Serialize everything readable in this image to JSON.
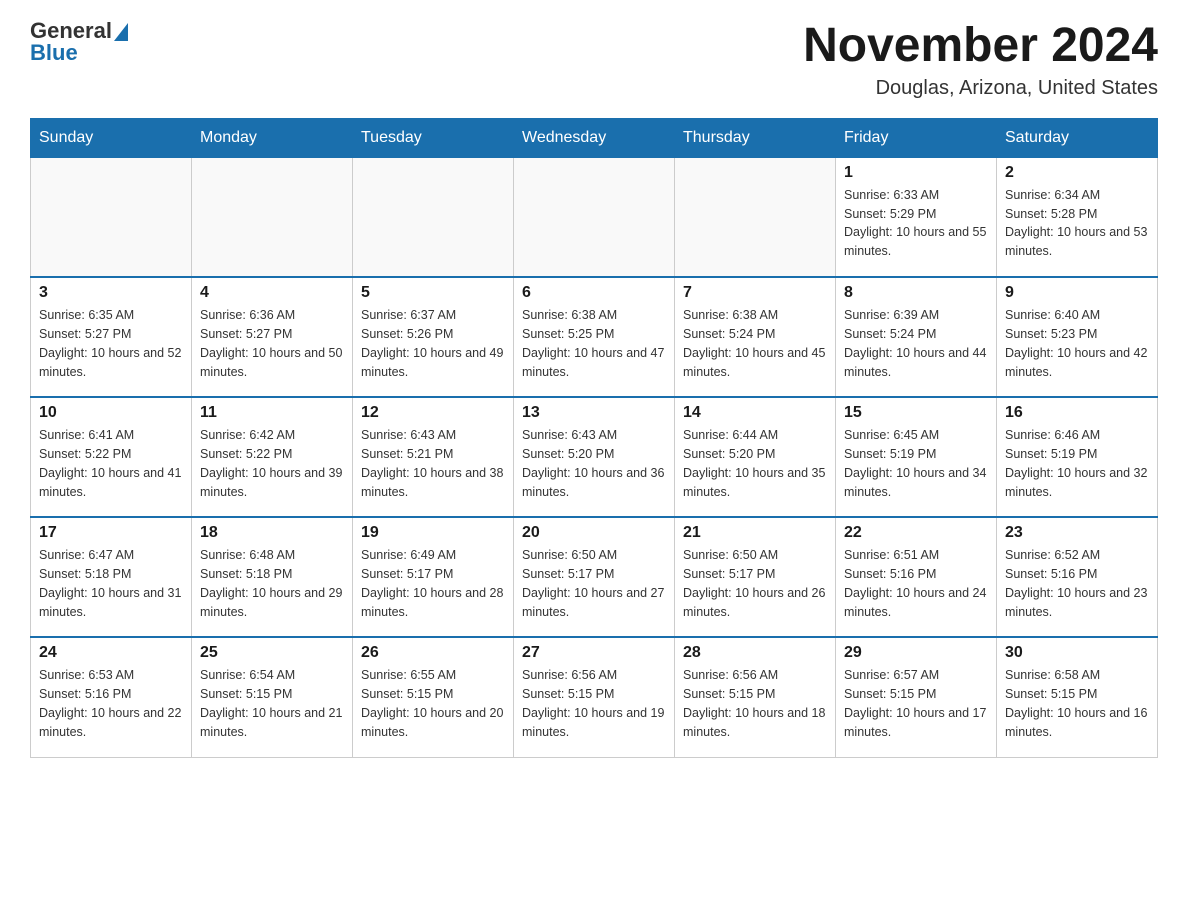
{
  "header": {
    "logo_general": "General",
    "logo_blue": "Blue",
    "month_title": "November 2024",
    "location": "Douglas, Arizona, United States"
  },
  "days_of_week": [
    "Sunday",
    "Monday",
    "Tuesday",
    "Wednesday",
    "Thursday",
    "Friday",
    "Saturday"
  ],
  "weeks": [
    [
      {
        "day": "",
        "info": ""
      },
      {
        "day": "",
        "info": ""
      },
      {
        "day": "",
        "info": ""
      },
      {
        "day": "",
        "info": ""
      },
      {
        "day": "",
        "info": ""
      },
      {
        "day": "1",
        "info": "Sunrise: 6:33 AM\nSunset: 5:29 PM\nDaylight: 10 hours and 55 minutes."
      },
      {
        "day": "2",
        "info": "Sunrise: 6:34 AM\nSunset: 5:28 PM\nDaylight: 10 hours and 53 minutes."
      }
    ],
    [
      {
        "day": "3",
        "info": "Sunrise: 6:35 AM\nSunset: 5:27 PM\nDaylight: 10 hours and 52 minutes."
      },
      {
        "day": "4",
        "info": "Sunrise: 6:36 AM\nSunset: 5:27 PM\nDaylight: 10 hours and 50 minutes."
      },
      {
        "day": "5",
        "info": "Sunrise: 6:37 AM\nSunset: 5:26 PM\nDaylight: 10 hours and 49 minutes."
      },
      {
        "day": "6",
        "info": "Sunrise: 6:38 AM\nSunset: 5:25 PM\nDaylight: 10 hours and 47 minutes."
      },
      {
        "day": "7",
        "info": "Sunrise: 6:38 AM\nSunset: 5:24 PM\nDaylight: 10 hours and 45 minutes."
      },
      {
        "day": "8",
        "info": "Sunrise: 6:39 AM\nSunset: 5:24 PM\nDaylight: 10 hours and 44 minutes."
      },
      {
        "day": "9",
        "info": "Sunrise: 6:40 AM\nSunset: 5:23 PM\nDaylight: 10 hours and 42 minutes."
      }
    ],
    [
      {
        "day": "10",
        "info": "Sunrise: 6:41 AM\nSunset: 5:22 PM\nDaylight: 10 hours and 41 minutes."
      },
      {
        "day": "11",
        "info": "Sunrise: 6:42 AM\nSunset: 5:22 PM\nDaylight: 10 hours and 39 minutes."
      },
      {
        "day": "12",
        "info": "Sunrise: 6:43 AM\nSunset: 5:21 PM\nDaylight: 10 hours and 38 minutes."
      },
      {
        "day": "13",
        "info": "Sunrise: 6:43 AM\nSunset: 5:20 PM\nDaylight: 10 hours and 36 minutes."
      },
      {
        "day": "14",
        "info": "Sunrise: 6:44 AM\nSunset: 5:20 PM\nDaylight: 10 hours and 35 minutes."
      },
      {
        "day": "15",
        "info": "Sunrise: 6:45 AM\nSunset: 5:19 PM\nDaylight: 10 hours and 34 minutes."
      },
      {
        "day": "16",
        "info": "Sunrise: 6:46 AM\nSunset: 5:19 PM\nDaylight: 10 hours and 32 minutes."
      }
    ],
    [
      {
        "day": "17",
        "info": "Sunrise: 6:47 AM\nSunset: 5:18 PM\nDaylight: 10 hours and 31 minutes."
      },
      {
        "day": "18",
        "info": "Sunrise: 6:48 AM\nSunset: 5:18 PM\nDaylight: 10 hours and 29 minutes."
      },
      {
        "day": "19",
        "info": "Sunrise: 6:49 AM\nSunset: 5:17 PM\nDaylight: 10 hours and 28 minutes."
      },
      {
        "day": "20",
        "info": "Sunrise: 6:50 AM\nSunset: 5:17 PM\nDaylight: 10 hours and 27 minutes."
      },
      {
        "day": "21",
        "info": "Sunrise: 6:50 AM\nSunset: 5:17 PM\nDaylight: 10 hours and 26 minutes."
      },
      {
        "day": "22",
        "info": "Sunrise: 6:51 AM\nSunset: 5:16 PM\nDaylight: 10 hours and 24 minutes."
      },
      {
        "day": "23",
        "info": "Sunrise: 6:52 AM\nSunset: 5:16 PM\nDaylight: 10 hours and 23 minutes."
      }
    ],
    [
      {
        "day": "24",
        "info": "Sunrise: 6:53 AM\nSunset: 5:16 PM\nDaylight: 10 hours and 22 minutes."
      },
      {
        "day": "25",
        "info": "Sunrise: 6:54 AM\nSunset: 5:15 PM\nDaylight: 10 hours and 21 minutes."
      },
      {
        "day": "26",
        "info": "Sunrise: 6:55 AM\nSunset: 5:15 PM\nDaylight: 10 hours and 20 minutes."
      },
      {
        "day": "27",
        "info": "Sunrise: 6:56 AM\nSunset: 5:15 PM\nDaylight: 10 hours and 19 minutes."
      },
      {
        "day": "28",
        "info": "Sunrise: 6:56 AM\nSunset: 5:15 PM\nDaylight: 10 hours and 18 minutes."
      },
      {
        "day": "29",
        "info": "Sunrise: 6:57 AM\nSunset: 5:15 PM\nDaylight: 10 hours and 17 minutes."
      },
      {
        "day": "30",
        "info": "Sunrise: 6:58 AM\nSunset: 5:15 PM\nDaylight: 10 hours and 16 minutes."
      }
    ]
  ]
}
